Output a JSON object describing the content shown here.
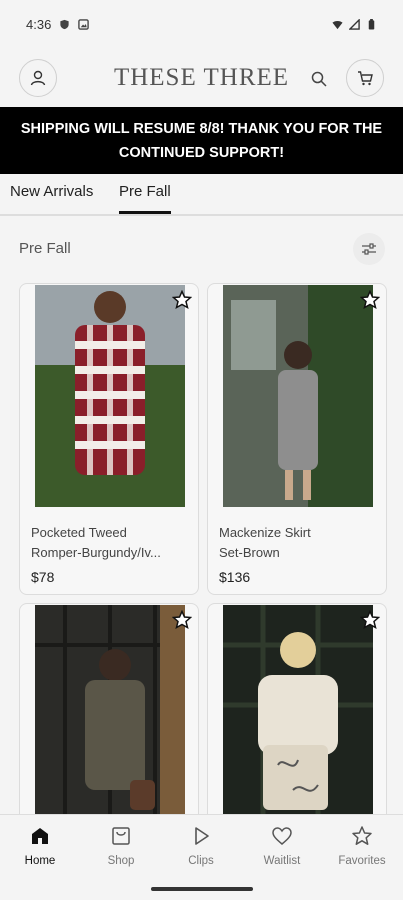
{
  "status_bar": {
    "time": "4:36"
  },
  "header": {
    "logo_text": "THESE THREE"
  },
  "banner": {
    "text": "SHIPPING WILL RESUME 8/8! THANK YOU FOR THE CONTINUED SUPPORT!"
  },
  "tabs": [
    {
      "label": "New Arrivals",
      "active": false
    },
    {
      "label": "Pre Fall",
      "active": true
    }
  ],
  "section": {
    "title": "Pre Fall"
  },
  "products": [
    {
      "name_line1": "Pocketed Tweed",
      "name_line2": "Romper-Burgundy/Iv...",
      "price": "$78",
      "colors": [
        "#8a1f2a",
        "#f2eee8",
        "#3c5a2a"
      ]
    },
    {
      "name_line1": "Mackenize Skirt",
      "name_line2": "Set-Brown",
      "price": "$136",
      "colors": [
        "#8e8e8e",
        "#4e5a4c",
        "#2f4a28"
      ]
    },
    {
      "name_line1": "",
      "name_line2": "",
      "price": "",
      "colors": [
        "#5a5648",
        "#2b2b28",
        "#7a5c3a"
      ]
    },
    {
      "name_line1": "",
      "name_line2": "",
      "price": "",
      "colors": [
        "#e9e3d6",
        "#2f3a2c",
        "#1e241e"
      ]
    }
  ],
  "bottom_nav": [
    {
      "label": "Home",
      "icon": "home-icon",
      "active": true
    },
    {
      "label": "Shop",
      "icon": "shop-icon",
      "active": false
    },
    {
      "label": "Clips",
      "icon": "play-icon",
      "active": false
    },
    {
      "label": "Waitlist",
      "icon": "heart-icon",
      "active": false
    },
    {
      "label": "Favorites",
      "icon": "star-icon",
      "active": false
    }
  ]
}
